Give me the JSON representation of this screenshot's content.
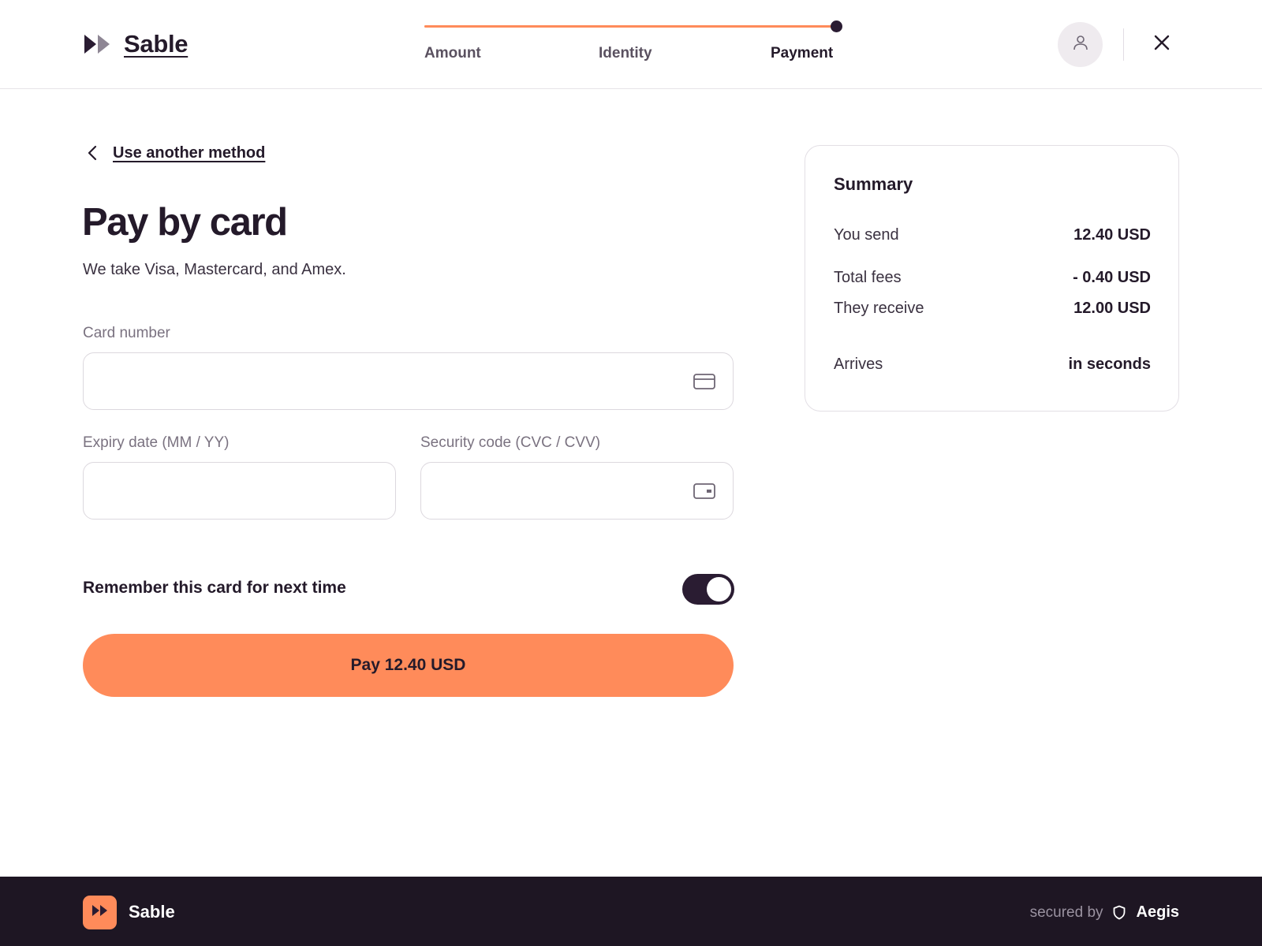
{
  "header": {
    "brand_name": "Sable",
    "steps": [
      {
        "label": "Amount",
        "state": "done"
      },
      {
        "label": "Identity",
        "state": "done"
      },
      {
        "label": "Payment",
        "state": "current"
      }
    ],
    "progress_fraction": 1.0,
    "icons": {
      "brand": "fast-forward-icon",
      "avatar": "user-icon",
      "close": "close-icon"
    }
  },
  "main": {
    "back_link": "Use another method",
    "title": "Pay by card",
    "subtitle": "We take Visa, Mastercard, and Amex.",
    "card_number": {
      "label": "Card number",
      "value": "",
      "placeholder": "",
      "icon": "credit-card-icon"
    },
    "expiry": {
      "label": "Expiry date (MM / YY)",
      "value": "",
      "placeholder": ""
    },
    "security": {
      "label": "Security code (CVC / CVV)",
      "value": "",
      "placeholder": "",
      "icon": "card-back-icon"
    },
    "remember": {
      "label": "Remember this card for next time",
      "checked": true
    },
    "pay_button": "Pay 12.40 USD"
  },
  "summary": {
    "title": "Summary",
    "rows": [
      {
        "key": "You send",
        "value": "12.40 USD"
      },
      {
        "key": "Total fees",
        "value": "- 0.40 USD"
      },
      {
        "key": "They receive",
        "value": "12.00 USD"
      },
      {
        "key": "Arrives",
        "value": "in seconds"
      }
    ]
  },
  "footer": {
    "brand_name": "Sable",
    "secured_by": "secured by",
    "security_brand": "Aegis",
    "icons": {
      "logo": "fast-forward-icon",
      "shield": "shield-icon"
    }
  },
  "colors": {
    "accent": "#ff8b5a",
    "ink": "#241a2a",
    "footer_bg": "#1e1623",
    "toggle_on": "#2a1c32"
  }
}
